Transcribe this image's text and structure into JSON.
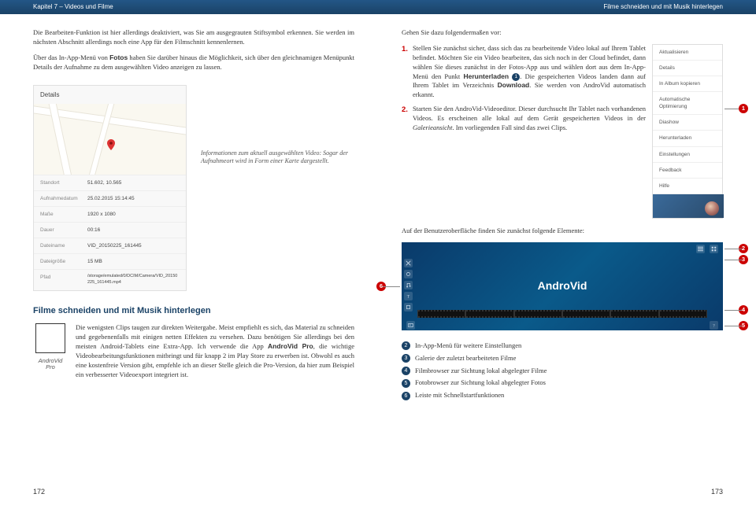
{
  "header": {
    "left": "Kapitel 7 – Videos und Filme",
    "right": "Filme schneiden und mit Musik hinterlegen"
  },
  "left": {
    "p1": "Die Bearbeiten-Funktion ist hier allerdings deaktiviert, was Sie am ausgegrauten Stiftsymbol erkennen. Sie werden im nächsten Abschnitt allerdings noch eine App für den Filmschnitt kennenlernen.",
    "p2a": "Über das In-App-Menü von ",
    "p2b": "Fotos",
    "p2c": " haben Sie darüber hinaus die Möglichkeit, sich über den gleichnamigen Menüpunkt Details der Aufnahme zu dem ausgewählten Video anzeigen zu lassen.",
    "details": {
      "title": "Details",
      "rows": [
        {
          "label": "Standort",
          "value": "51.602, 10.565"
        },
        {
          "label": "Aufnahmedatum",
          "value": "25.02.2015 15:14:45"
        },
        {
          "label": "Maße",
          "value": "1920 x 1080"
        },
        {
          "label": "Dauer",
          "value": "00:16"
        },
        {
          "label": "Dateiname",
          "value": "VID_20150225_161445"
        },
        {
          "label": "Dateigröße",
          "value": "15 MB"
        },
        {
          "label": "Pfad",
          "value": "/storage/emulated/0/DCIM/Camera/VID_20150225_161445.mp4"
        }
      ]
    },
    "caption": "Informationen zum aktuell ausgewählten Video: Sogar der Aufnahmeort wird in Form einer Karte dargestellt.",
    "section": "Filme schneiden und mit Musik hinterlegen",
    "qr": "AndroVid Pro",
    "p3a": "Die wenigsten Clips taugen zur direkten Weitergabe. Meist empfiehlt es sich, das Material zu schneiden und gegebenenfalls mit einigen netten Effekten zu versehen. Dazu benötigen Sie allerdings bei den meisten Android-Tablets eine Extra-App. Ich verwende die App ",
    "p3b": "AndroVid Pro",
    "p3c": ", die wichtige Videobearbeitungsfunktionen mitbringt und für knapp 2 im Play Store zu erwerben ist. Obwohl es auch eine kostenfreie Version gibt, empfehle ich an dieser Stelle gleich die Pro-Version, da hier zum Beispiel ein verbesserter Videoexport integriert ist."
  },
  "right": {
    "intro": "Gehen Sie dazu folgendermaßen vor:",
    "menu": [
      "Aktualisieren",
      "Details",
      "In Album kopieren",
      "Automatische Optimierung",
      "Diashow",
      "Herunterladen",
      "Einstellungen",
      "Feedback",
      "Hilfe"
    ],
    "step1a": "Stellen Sie zunächst sicher, dass sich das zu bearbeitende Video lokal auf Ihrem Tablet befindet. Möchten Sie ein Video bearbeiten, das sich noch in der Cloud befindet, dann wählen Sie dieses zunächst in der Fotos-App aus und wählen dort aus dem In-App-Menü den Punkt ",
    "step1b": "Herunterladen",
    "step1c": ". Die gespeicherten Videos landen dann auf Ihrem Tablet im Verzeichnis ",
    "step1d": "Download",
    "step1e": ". Sie werden von AndroVid automatisch erkannt.",
    "step2a": "Starten Sie den AndroVid-Videoeditor. Dieser durchsucht Ihr Tablet nach vorhandenen Videos. Es erscheinen alle lokal auf dem Gerät gespeicherten Videos in der ",
    "step2b": "Galerieansicht",
    "step2c": ". Im vorliegenden Fall sind das zwei Clips.",
    "after": "Auf der Benutzeroberfläche finden Sie zunächst folgende Elemente:",
    "logo": "AndroVid",
    "legend": [
      {
        "n": "2",
        "t": "In-App-Menü für weitere Einstellungen"
      },
      {
        "n": "3",
        "t": "Galerie der zuletzt bearbeiteten Filme"
      },
      {
        "n": "4",
        "t": "Filmbrowser zur Sichtung lokal abgelegter Filme"
      },
      {
        "n": "5",
        "t": "Fotobrowser zur Sichtung lokal abgelegter Fotos"
      },
      {
        "n": "6",
        "t": "Leiste mit Schnellstartfunktionen"
      }
    ]
  },
  "pages": {
    "l": "172",
    "r": "173"
  },
  "callouts": {
    "c1": "1",
    "c2": "2",
    "c3": "3",
    "c4": "4",
    "c5": "5",
    "c6": "6"
  }
}
